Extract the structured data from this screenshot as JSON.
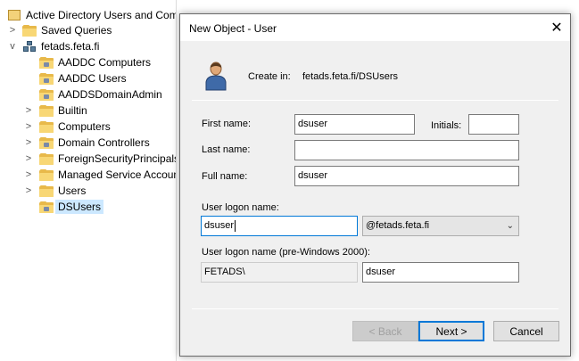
{
  "tree": {
    "root_label": "Active Directory Users and Com",
    "items": [
      {
        "label": "Saved Queries",
        "chevron": ">"
      },
      {
        "label": "fetads.feta.fi",
        "chevron": "v"
      },
      {
        "label": "AADDC Computers",
        "chevron": ""
      },
      {
        "label": "AADDC Users",
        "chevron": ""
      },
      {
        "label": "AADDSDomainAdmin",
        "chevron": ""
      },
      {
        "label": "Builtin",
        "chevron": ">"
      },
      {
        "label": "Computers",
        "chevron": ">"
      },
      {
        "label": "Domain Controllers",
        "chevron": ">"
      },
      {
        "label": "ForeignSecurityPrincipals",
        "chevron": ">"
      },
      {
        "label": "Managed Service Accounts",
        "chevron": ">"
      },
      {
        "label": "Users",
        "chevron": ">"
      },
      {
        "label": "DSUsers",
        "chevron": ""
      }
    ],
    "selected": "DSUsers"
  },
  "dialog": {
    "title": "New Object - User",
    "close_glyph": "✕",
    "create_in_label": "Create in:",
    "create_in_value": "fetads.feta.fi/DSUsers",
    "first_name_label": "First name:",
    "first_name_value": "dsuser",
    "initials_label": "Initials:",
    "initials_value": "",
    "last_name_label": "Last name:",
    "last_name_value": "",
    "full_name_label": "Full name:",
    "full_name_value": "dsuser",
    "logon_name_label": "User logon name:",
    "logon_name_value": "dsuser",
    "domain_suffix": "@fetads.feta.fi",
    "pre2000_label": "User logon name (pre-Windows 2000):",
    "pre2000_domain": "FETADS\\",
    "pre2000_value": "dsuser",
    "back_label": "< Back",
    "next_label": "Next >",
    "cancel_label": "Cancel"
  },
  "icons": {
    "user": "user-icon",
    "folder": "folder-icon",
    "domain": "domain-icon",
    "close": "close-icon",
    "dropdown": "chevron-down-icon"
  },
  "colors": {
    "selection": "#cce8ff",
    "focus_border": "#0078d7",
    "folder": "#f8d775"
  }
}
